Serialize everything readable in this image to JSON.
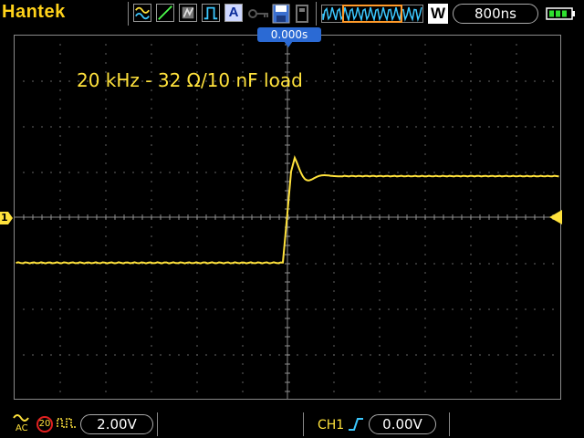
{
  "app": {
    "brand": "Hantek"
  },
  "header": {
    "window_label": "W",
    "timebase": "800ns",
    "trigger_position": "0.000s",
    "acquire_mode_label": "A"
  },
  "annotation": {
    "text": "20 kHz - 32 Ω/10 nF load"
  },
  "channel1": {
    "marker": "1",
    "volts_per_div": "2.00V",
    "coupling": "AC",
    "bw_limit": "20"
  },
  "trigger": {
    "source": "CH1",
    "level": "0.00V"
  },
  "colors": {
    "trace": "#ffe23c",
    "grid": "#8a8a8a",
    "accent": "#2b6ad4",
    "brand": "#ffd21a"
  },
  "waveform": {
    "description_type": "step",
    "levels_div": {
      "low": -1.0,
      "high": 0.9
    },
    "overshoot_peak_div": 1.3,
    "time_div_range": [
      -5,
      5
    ]
  }
}
